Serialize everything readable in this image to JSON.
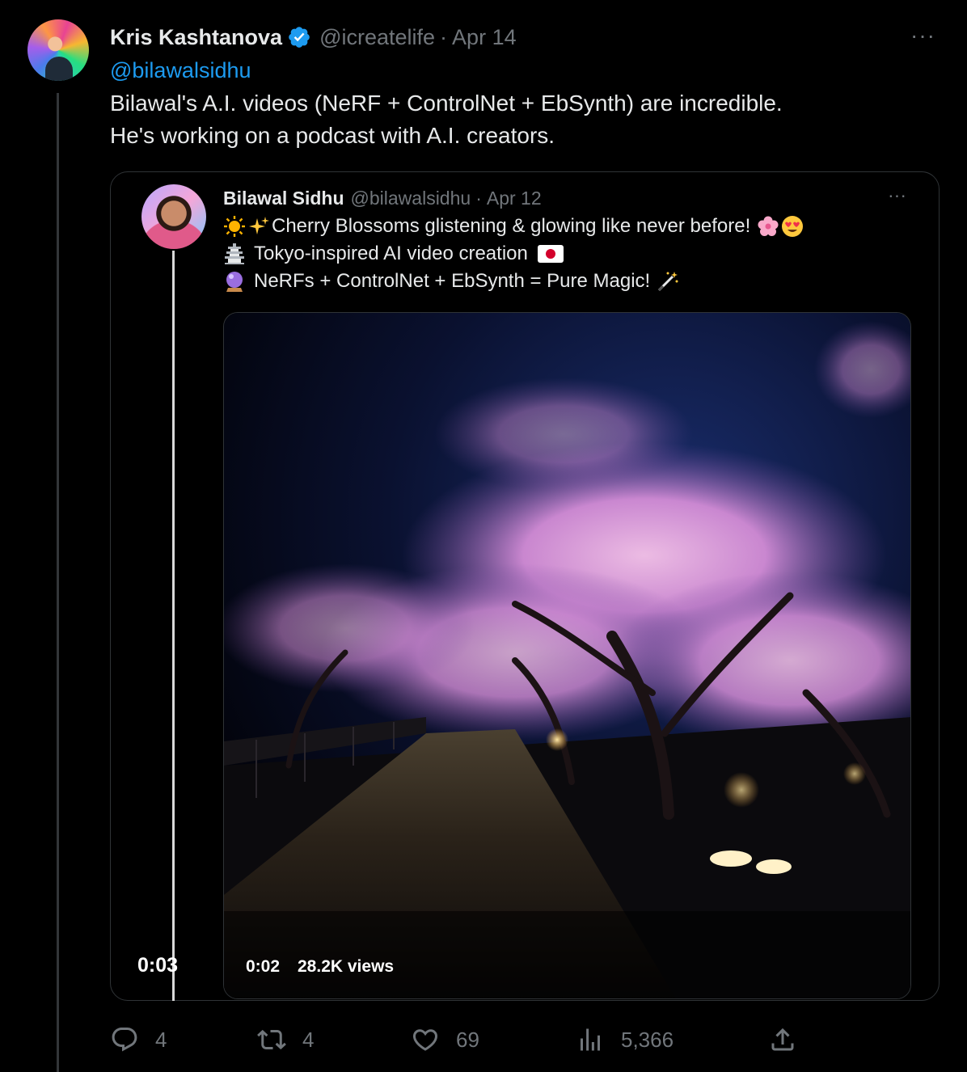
{
  "tweet": {
    "author_name": "Kris Kashtanova",
    "author_handle": "@icreatelife",
    "separator": "·",
    "date": "Apr 14",
    "more": "···",
    "mention": "@bilawalsidhu",
    "text_lines": [
      "Bilawal's A.I. videos (NeRF + ControlNet + EbSynth) are incredible.",
      "He's working on a podcast with A.I. creators."
    ]
  },
  "quoted": {
    "author_name": "Bilawal Sidhu",
    "author_handle": "@bilawalsidhu",
    "separator": "·",
    "date": "Apr 12",
    "more": "···",
    "lines": [
      {
        "icons": [
          "sun-emoji-icon",
          "sparkles-emoji-icon"
        ],
        "text": "Cherry Blossoms glistening & glowing like never before!",
        "trail_icons": [
          "cherry-blossom-emoji-icon",
          "heart-eyes-emoji-icon"
        ]
      },
      {
        "icons": [
          "pagoda-emoji-icon"
        ],
        "text": "Tokyo-inspired AI video creation",
        "trail_icons": [
          "japan-flag-emoji-icon"
        ]
      },
      {
        "icons": [
          "crystal-ball-emoji-icon"
        ],
        "text": "NeRFs + ControlNet + EbSynth = Pure Magic!",
        "trail_icons": [
          "magic-wand-emoji-icon"
        ]
      }
    ],
    "video": {
      "elapsed": "0:02",
      "views": "28.2K views"
    }
  },
  "outer_video_time": "0:03",
  "actions": {
    "reply_count": "4",
    "retweet_count": "4",
    "like_count": "69",
    "views_count": "5,366"
  },
  "colors": {
    "background": "#000000",
    "text": "#e7e9ea",
    "muted": "#71767b",
    "link": "#1d9bf0",
    "border": "#2f3336"
  }
}
